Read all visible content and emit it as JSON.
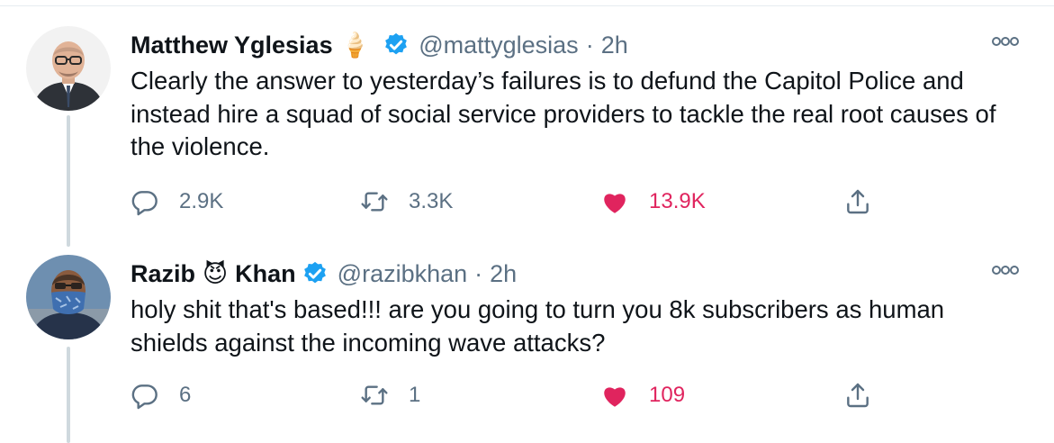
{
  "tweets": [
    {
      "name": "Matthew Yglesias",
      "name_emoji": "🍦",
      "handle": "@mattyglesias",
      "separator": "·",
      "time": "2h",
      "text": "Clearly the answer to yesterday’s failures is to defund the Capitol Police and instead hire a squad of social service providers to tackle the real root causes of the violence.",
      "replies": "2.9K",
      "retweets": "3.3K",
      "likes": "13.9K",
      "liked": true,
      "verified": true
    },
    {
      "name_first": "Razib",
      "name_emoji": "😈",
      "name_last": "Khan",
      "handle": "@razibkhan",
      "separator": "·",
      "time": "2h",
      "text": "holy shit that's based!!! are you going to turn you 8k subscribers as human shields against the incoming wave attacks?",
      "replies": "6",
      "retweets": "1",
      "likes": "109",
      "liked": true,
      "verified": true
    }
  ],
  "colors": {
    "verified": "#1da1f2",
    "like": "#e0245e",
    "secondary_text": "#5b7083",
    "thread_line": "#cfd9de"
  },
  "icons": [
    "reply-icon",
    "retweet-icon",
    "heart-icon",
    "share-icon",
    "more-icon",
    "verified-badge-icon"
  ]
}
